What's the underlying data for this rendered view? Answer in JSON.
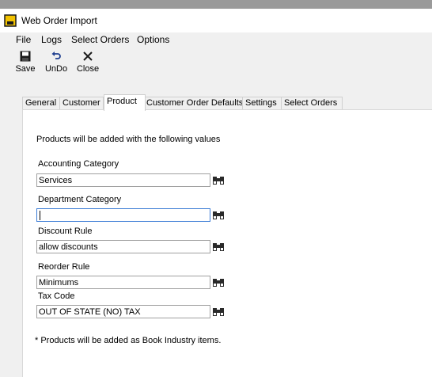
{
  "window": {
    "title": "Web Order Import"
  },
  "menu": {
    "file": "File",
    "logs": "Logs",
    "select_orders": "Select Orders",
    "options": "Options"
  },
  "toolbar": {
    "save": "Save",
    "undo": "UnDo",
    "close": "Close"
  },
  "tabs": {
    "general": "General",
    "customer": "Customer",
    "product": "Product",
    "customer_order_defaults": "Customer Order Defaults",
    "settings": "Settings",
    "select_orders": "Select Orders",
    "active": "Product"
  },
  "product": {
    "intro": "Products will be added with the following values",
    "accounting_category": {
      "label": "Accounting Category",
      "value": "Services"
    },
    "department_category": {
      "label": "Department Category",
      "value": ""
    },
    "discount_rule": {
      "label": "Discount Rule",
      "value": "allow discounts"
    },
    "reorder_rule": {
      "label": "Reorder Rule",
      "value": "Minimums"
    },
    "tax_code": {
      "label": "Tax Code",
      "value": "OUT OF STATE (NO) TAX"
    },
    "note": "* Products will be added as Book Industry items."
  },
  "icons": {
    "app": "app-icon",
    "save": "floppy-disk-icon",
    "undo": "undo-arrow-icon",
    "close": "x-icon",
    "lookup": "binoculars-icon"
  }
}
